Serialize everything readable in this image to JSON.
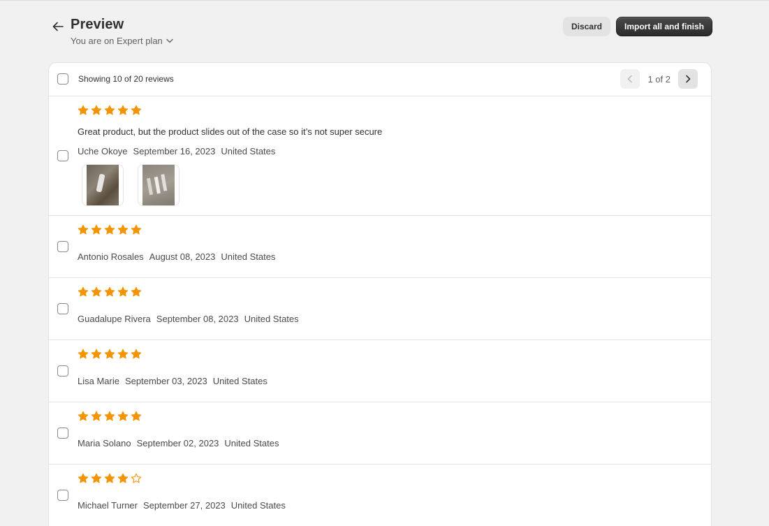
{
  "header": {
    "title": "Preview",
    "plan_label": "You are on Expert plan",
    "discard_label": "Discard",
    "import_label": "Import all and finish"
  },
  "list": {
    "showing_label": "Showing 10 of 20 reviews",
    "page_label": "1 of 2"
  },
  "colors": {
    "star": "#f49400",
    "primary_button": "#303030"
  },
  "reviews": [
    {
      "rating": 5,
      "text": "Great product, but the product slides out of the case so it’s not super secure",
      "author": "Uche Okoye",
      "date": "September 16, 2023",
      "country": "United States",
      "images": [
        "photo-1",
        "photo-2"
      ]
    },
    {
      "rating": 5,
      "text": "",
      "author": "Antonio Rosales",
      "date": "August 08, 2023",
      "country": "United States",
      "images": []
    },
    {
      "rating": 5,
      "text": "",
      "author": "Guadalupe Rivera",
      "date": "September 08, 2023",
      "country": "United States",
      "images": []
    },
    {
      "rating": 5,
      "text": "",
      "author": "Lisa Marie",
      "date": "September 03, 2023",
      "country": "United States",
      "images": []
    },
    {
      "rating": 5,
      "text": "",
      "author": "Maria Solano",
      "date": "September 02, 2023",
      "country": "United States",
      "images": []
    },
    {
      "rating": 4,
      "text": "",
      "author": "Michael Turner",
      "date": "September 27, 2023",
      "country": "United States",
      "images": []
    }
  ]
}
